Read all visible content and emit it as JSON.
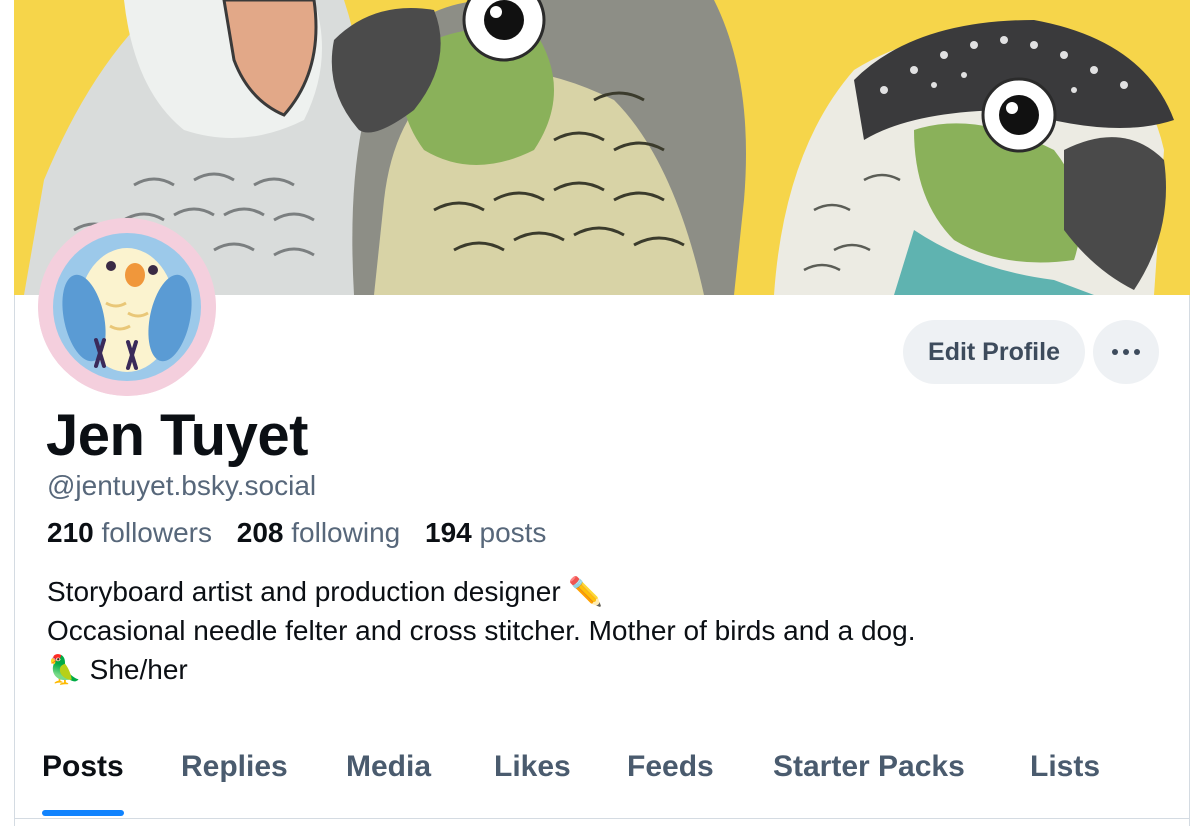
{
  "profile": {
    "display_name": "Jen Tuyet",
    "handle": "@jentuyet.bsky.social",
    "stats": {
      "followers_count": "210",
      "followers_label": "followers",
      "following_count": "208",
      "following_label": "following",
      "posts_count": "194",
      "posts_label": "posts"
    },
    "bio": {
      "line1": "Storyboard artist and production designer ✏️",
      "line2": "Occasional needle felter and cross stitcher. Mother of birds and a dog.",
      "line3": "🦜 She/her"
    }
  },
  "actions": {
    "edit_label": "Edit Profile",
    "more_icon": "ellipsis-icon"
  },
  "tabs": [
    {
      "label": "Posts",
      "active": true
    },
    {
      "label": "Replies",
      "active": false
    },
    {
      "label": "Media",
      "active": false
    },
    {
      "label": "Likes",
      "active": false
    },
    {
      "label": "Feeds",
      "active": false
    },
    {
      "label": "Starter Packs",
      "active": false
    },
    {
      "label": "Lists",
      "active": false
    }
  ],
  "colors": {
    "accent": "#1083fe",
    "banner_bg": "#f6d54a",
    "avatar_bg": "#f4cfdd",
    "secondary_text": "#57677a",
    "button_bg": "#eef1f4"
  }
}
